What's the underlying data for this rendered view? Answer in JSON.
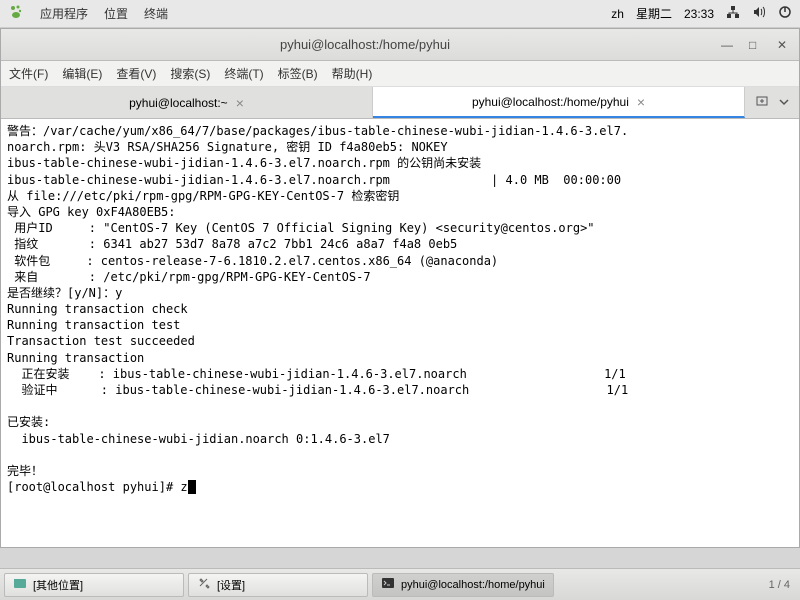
{
  "panel": {
    "apps": "应用程序",
    "places": "位置",
    "terminal": "终端",
    "lang": "zh",
    "day": "星期二",
    "time": "23:33"
  },
  "window": {
    "title": "pyhui@localhost:/home/pyhui"
  },
  "menu": {
    "file": "文件(F)",
    "edit": "编辑(E)",
    "view": "查看(V)",
    "search": "搜索(S)",
    "terminal": "终端(T)",
    "tabs": "标签(B)",
    "help": "帮助(H)"
  },
  "tabs": {
    "t0": "pyhui@localhost:~",
    "t1": "pyhui@localhost:/home/pyhui"
  },
  "term": {
    "l0": "警告：/var/cache/yum/x86_64/7/base/packages/ibus-table-chinese-wubi-jidian-1.4.6-3.el7.",
    "l1": "noarch.rpm: 头V3 RSA/SHA256 Signature, 密钥 ID f4a80eb5: NOKEY",
    "l2": "ibus-table-chinese-wubi-jidian-1.4.6-3.el7.noarch.rpm 的公钥尚未安装",
    "l3": "ibus-table-chinese-wubi-jidian-1.4.6-3.el7.noarch.rpm              | 4.0 MB  00:00:00",
    "l4": "从 file:///etc/pki/rpm-gpg/RPM-GPG-KEY-CentOS-7 检索密钥",
    "l5": "导入 GPG key 0xF4A80EB5:",
    "l6": " 用户ID     : \"CentOS-7 Key (CentOS 7 Official Signing Key) <security@centos.org>\"",
    "l7": " 指纹       : 6341 ab27 53d7 8a78 a7c2 7bb1 24c6 a8a7 f4a8 0eb5",
    "l8": " 软件包     : centos-release-7-6.1810.2.el7.centos.x86_64 (@anaconda)",
    "l9": " 来自       : /etc/pki/rpm-gpg/RPM-GPG-KEY-CentOS-7",
    "l10": "是否继续？[y/N]：y",
    "l11": "Running transaction check",
    "l12": "Running transaction test",
    "l13": "Transaction test succeeded",
    "l14": "Running transaction",
    "l15": "  正在安装    : ibus-table-chinese-wubi-jidian-1.4.6-3.el7.noarch                   1/1",
    "l16": "  验证中      : ibus-table-chinese-wubi-jidian-1.4.6-3.el7.noarch                   1/1",
    "l17": "",
    "l18": "已安装:",
    "l19": "  ibus-table-chinese-wubi-jidian.noarch 0:1.4.6-3.el7",
    "l20": "",
    "l21": "完毕！",
    "prompt": "[root@localhost pyhui]# z"
  },
  "taskbar": {
    "t0": "[其他位置]",
    "t1": "[设置]",
    "t2": "pyhui@localhost:/home/pyhui",
    "pager": "1 / 4"
  }
}
